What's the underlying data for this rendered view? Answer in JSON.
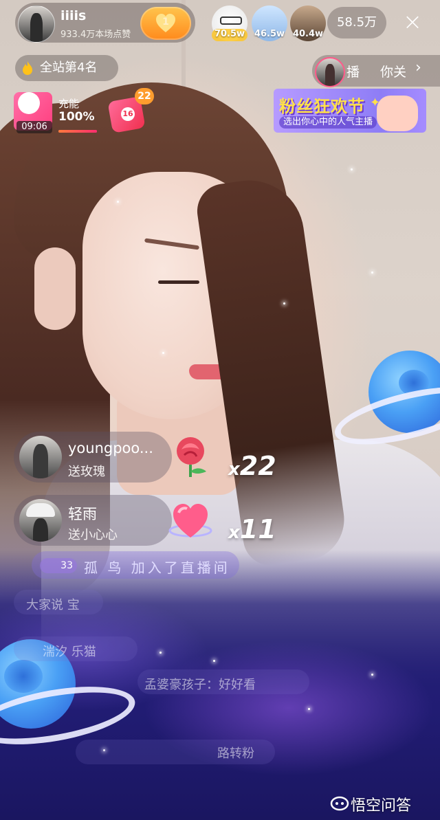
{
  "host": {
    "name": "iiiis",
    "likes": "933.4万本场点赞",
    "follow_level": "1"
  },
  "viewers": [
    {
      "count": "70.5w"
    },
    {
      "count": "46.5w"
    },
    {
      "count": "40.4w"
    }
  ],
  "viewer_total": "58.5万",
  "rank": "全站第4名",
  "pk": {
    "label1": "播",
    "label2": "你关",
    "chevron": "›"
  },
  "charge": {
    "label": "充能",
    "value": "100%",
    "timer": "09:06",
    "progress": 1.0
  },
  "gift_box": {
    "badge": "22",
    "label": "16"
  },
  "banner": {
    "title": "粉丝狂欢节",
    "subtitle": "选出你心中的人气主播"
  },
  "gift_messages": [
    {
      "user": "youngpoo...",
      "action": "送玫瑰",
      "count": "22",
      "multiplier": "x"
    },
    {
      "user": "轻雨",
      "action": "送小心心",
      "count": "11",
      "multiplier": "x"
    }
  ],
  "join": {
    "level": "33",
    "text": "孤 鸟 加入了直播间"
  },
  "chat_faded": [
    {
      "text": "大家说 宝"
    },
    {
      "text": "湍汐 乐猫"
    },
    {
      "text": "孟婆豪孩子：好好看"
    },
    {
      "text": "路转粉"
    }
  ],
  "watermark": "悟空问答",
  "colors": {
    "accent_orange": "#ff9d2e",
    "pink": "#ff3e7e",
    "banner_purple": "#8e7df6",
    "banner_yellow": "#ffe14a"
  }
}
